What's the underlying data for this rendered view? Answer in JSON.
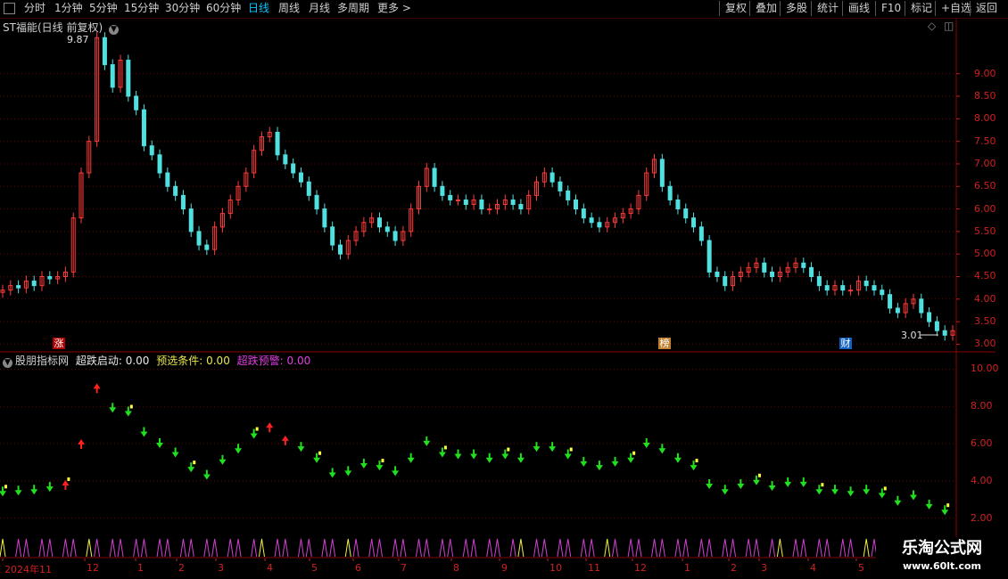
{
  "toolbar": {
    "periods": [
      "分时",
      "1分钟",
      "5分钟",
      "15分钟",
      "30分钟",
      "60分钟",
      "日线",
      "周线",
      "月线",
      "多周期",
      "更多 >"
    ],
    "active_period": "日线",
    "right_buttons": [
      "复权",
      "叠加",
      "多股",
      "统计",
      "画线",
      "F10",
      "标记",
      "+自选",
      "返回"
    ]
  },
  "main_chart": {
    "title": "ST福能(日线 前复权)",
    "high_label": "9.87",
    "low_label": "3.01",
    "y_ticks": [
      "9.00",
      "8.50",
      "8.00",
      "7.50",
      "7.00",
      "6.50",
      "6.00",
      "5.50",
      "5.00",
      "4.50",
      "4.00",
      "3.50",
      "3.00"
    ],
    "markers": [
      "涨",
      "榜",
      "财"
    ],
    "colors": {
      "up": "#ff3b3b",
      "down": "#50e0e0",
      "grid": "#6a0000"
    }
  },
  "indicator": {
    "name": "股朋指标网",
    "items": [
      {
        "label": "超跌启动: 0.00",
        "color": "#e8e8e8"
      },
      {
        "label": "预选条件: 0.00",
        "color": "#e8e850"
      },
      {
        "label": "超跌预警: 0.00",
        "color": "#e040e0"
      }
    ],
    "y_ticks": [
      "10.00",
      "8.00",
      "6.00",
      "4.00",
      "2.00"
    ]
  },
  "x_axis": {
    "labels": [
      "2024年11",
      "12",
      "1",
      "2",
      "3",
      "4",
      "5",
      "6",
      "7",
      "8",
      "9",
      "10",
      "11",
      "12",
      "1",
      "2",
      "3",
      "4",
      "5"
    ]
  },
  "watermark": {
    "cn": "乐淘公式网",
    "url": "www.60lt.com"
  },
  "chart_data": {
    "type": "candlestick",
    "title": "ST福能(日线 前复权)",
    "xlabel": "",
    "ylabel": "",
    "ylim": [
      3.0,
      9.9
    ],
    "high": 9.87,
    "low": 3.01,
    "close_series": [
      4.2,
      4.3,
      4.25,
      4.4,
      4.3,
      4.5,
      4.45,
      4.5,
      4.6,
      5.8,
      6.8,
      7.5,
      9.8,
      9.2,
      8.7,
      9.3,
      8.5,
      8.2,
      7.4,
      7.2,
      6.8,
      6.5,
      6.3,
      6.0,
      5.5,
      5.2,
      5.1,
      5.6,
      5.9,
      6.2,
      6.5,
      6.8,
      7.3,
      7.6,
      7.7,
      7.2,
      7.0,
      6.8,
      6.6,
      6.3,
      6.0,
      5.6,
      5.2,
      5.0,
      5.3,
      5.5,
      5.7,
      5.8,
      5.6,
      5.5,
      5.3,
      5.5,
      6.0,
      6.5,
      6.9,
      6.5,
      6.3,
      6.2,
      6.2,
      6.1,
      6.2,
      6.0,
      6.0,
      6.1,
      6.2,
      6.1,
      6.0,
      6.3,
      6.6,
      6.8,
      6.6,
      6.4,
      6.2,
      6.0,
      5.8,
      5.7,
      5.6,
      5.7,
      5.8,
      5.9,
      6.0,
      6.3,
      6.8,
      7.1,
      6.5,
      6.2,
      6.0,
      5.8,
      5.6,
      5.3,
      4.6,
      4.5,
      4.3,
      4.5,
      4.6,
      4.7,
      4.8,
      4.6,
      4.5,
      4.6,
      4.7,
      4.8,
      4.7,
      4.5,
      4.3,
      4.2,
      4.3,
      4.2,
      4.2,
      4.4,
      4.3,
      4.2,
      4.1,
      3.8,
      3.7,
      3.9,
      4.0,
      3.7,
      3.5,
      3.3,
      3.2,
      3.3
    ]
  }
}
